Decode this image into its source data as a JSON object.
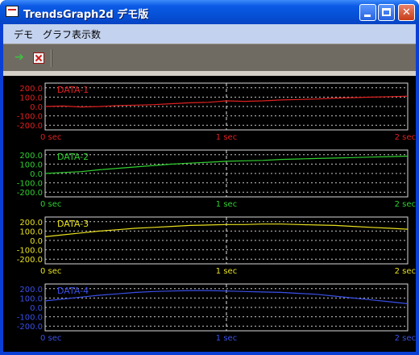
{
  "window": {
    "title": "TrendsGraph2d デモ版"
  },
  "menu": [
    "デモ",
    "グラフ表示数"
  ],
  "toolbar": {
    "run_icon": "green-arrow-icon",
    "stop_icon": "red-x-icon"
  },
  "chart_data": [
    {
      "type": "line",
      "title": "DATA-1",
      "color": "#e02020",
      "ylim": [
        -250,
        250
      ],
      "yticks": [
        "200.0",
        "100.0",
        "0.0",
        "-100.0",
        "-200.0"
      ],
      "xticks": [
        "0 sec",
        "1 sec",
        "2 sec"
      ],
      "grid": true,
      "series": [
        {
          "name": "DATA-1",
          "x": [
            0,
            0.1,
            0.2,
            0.3,
            0.4,
            0.5,
            0.6,
            0.7,
            0.8,
            0.9,
            1.0,
            1.1,
            1.2,
            1.3,
            1.4,
            1.5,
            1.6,
            1.7,
            1.8,
            1.9,
            2.0
          ],
          "values": [
            0,
            5,
            -5,
            0,
            10,
            15,
            20,
            30,
            40,
            45,
            60,
            55,
            60,
            70,
            75,
            80,
            90,
            95,
            100,
            105,
            110
          ]
        }
      ]
    },
    {
      "type": "line",
      "title": "DATA-2",
      "color": "#30d030",
      "ylim": [
        -250,
        250
      ],
      "yticks": [
        "200.0",
        "100.0",
        "0.0",
        "-100.0",
        "-200.0"
      ],
      "xticks": [
        "0 sec",
        "1 sec",
        "2 sec"
      ],
      "grid": true,
      "series": [
        {
          "name": "DATA-2",
          "x": [
            0,
            0.1,
            0.2,
            0.3,
            0.4,
            0.5,
            0.6,
            0.7,
            0.8,
            0.9,
            1.0,
            1.1,
            1.2,
            1.3,
            1.4,
            1.5,
            1.6,
            1.7,
            1.8,
            1.9,
            2.0
          ],
          "values": [
            0,
            10,
            20,
            40,
            55,
            70,
            85,
            100,
            110,
            120,
            130,
            135,
            140,
            150,
            155,
            160,
            165,
            170,
            175,
            180,
            185
          ]
        }
      ]
    },
    {
      "type": "line",
      "title": "DATA-3",
      "color": "#e8e020",
      "ylim": [
        -250,
        250
      ],
      "yticks": [
        "200.0",
        "100.0",
        "0.0",
        "-100.0",
        "-200.0"
      ],
      "xticks": [
        "0 sec",
        "1 sec",
        "2 sec"
      ],
      "grid": true,
      "series": [
        {
          "name": "DATA-3",
          "x": [
            0,
            0.1,
            0.2,
            0.3,
            0.4,
            0.5,
            0.6,
            0.7,
            0.8,
            0.9,
            1.0,
            1.1,
            1.2,
            1.3,
            1.4,
            1.5,
            1.6,
            1.7,
            1.8,
            1.9,
            2.0
          ],
          "values": [
            40,
            60,
            80,
            100,
            115,
            130,
            140,
            150,
            160,
            165,
            170,
            170,
            175,
            175,
            170,
            165,
            160,
            150,
            140,
            130,
            120
          ]
        }
      ]
    },
    {
      "type": "line",
      "title": "DATA-4",
      "color": "#3a50e8",
      "ylim": [
        -250,
        250
      ],
      "yticks": [
        "200.0",
        "100.0",
        "0.0",
        "-100.0",
        "-200.0"
      ],
      "xticks": [
        "0 sec",
        "1 sec",
        "2 sec"
      ],
      "grid": true,
      "series": [
        {
          "name": "DATA-4",
          "x": [
            0,
            0.1,
            0.2,
            0.3,
            0.4,
            0.5,
            0.6,
            0.7,
            0.8,
            0.9,
            1.0,
            1.1,
            1.2,
            1.3,
            1.4,
            1.5,
            1.6,
            1.7,
            1.8,
            1.9,
            2.0
          ],
          "values": [
            70,
            90,
            110,
            130,
            145,
            160,
            170,
            175,
            180,
            180,
            175,
            170,
            165,
            160,
            150,
            140,
            120,
            100,
            80,
            60,
            40
          ]
        }
      ]
    }
  ]
}
